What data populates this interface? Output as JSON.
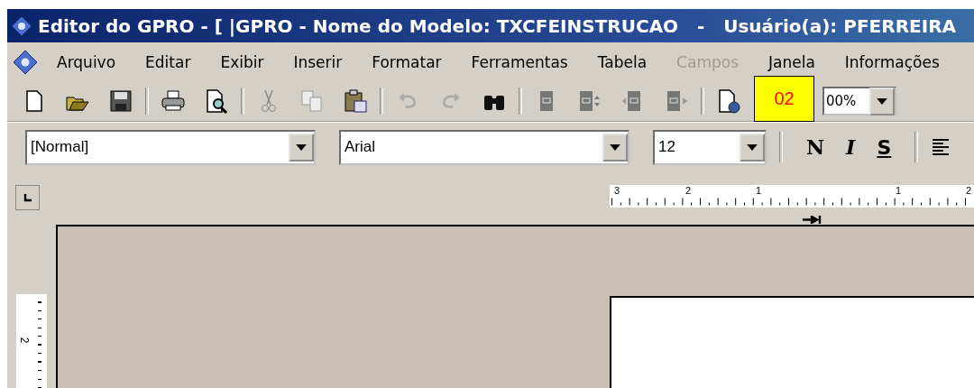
{
  "window": {
    "title": "Editor do GPRO - [ |GPRO - Nome do Modelo: TXCFEINSTRUCAO   -   Usuário(a): PFERREIRA"
  },
  "menu": [
    {
      "label": "Arquivo",
      "disabled": false
    },
    {
      "label": "Editar",
      "disabled": false
    },
    {
      "label": "Exibir",
      "disabled": false
    },
    {
      "label": "Inserir",
      "disabled": false
    },
    {
      "label": "Formatar",
      "disabled": false
    },
    {
      "label": "Ferramentas",
      "disabled": false
    },
    {
      "label": "Tabela",
      "disabled": false
    },
    {
      "label": "Campos",
      "disabled": true
    },
    {
      "label": "Janela",
      "disabled": false
    },
    {
      "label": "Informações",
      "disabled": false
    }
  ],
  "toolbar": {
    "annotation": "02",
    "zoom": "00%"
  },
  "format_bar": {
    "style": "[Normal]",
    "font": "Arial",
    "size": "12",
    "buttons": [
      {
        "label": "N",
        "kind": "bold"
      },
      {
        "label": "I",
        "kind": "italic"
      },
      {
        "label": "S",
        "kind": "underline"
      }
    ]
  },
  "horizontal_ruler": {
    "labels": [
      "3",
      "2",
      "1",
      "1",
      "2"
    ]
  },
  "vertical_ruler": {
    "labels": [
      "2"
    ]
  }
}
